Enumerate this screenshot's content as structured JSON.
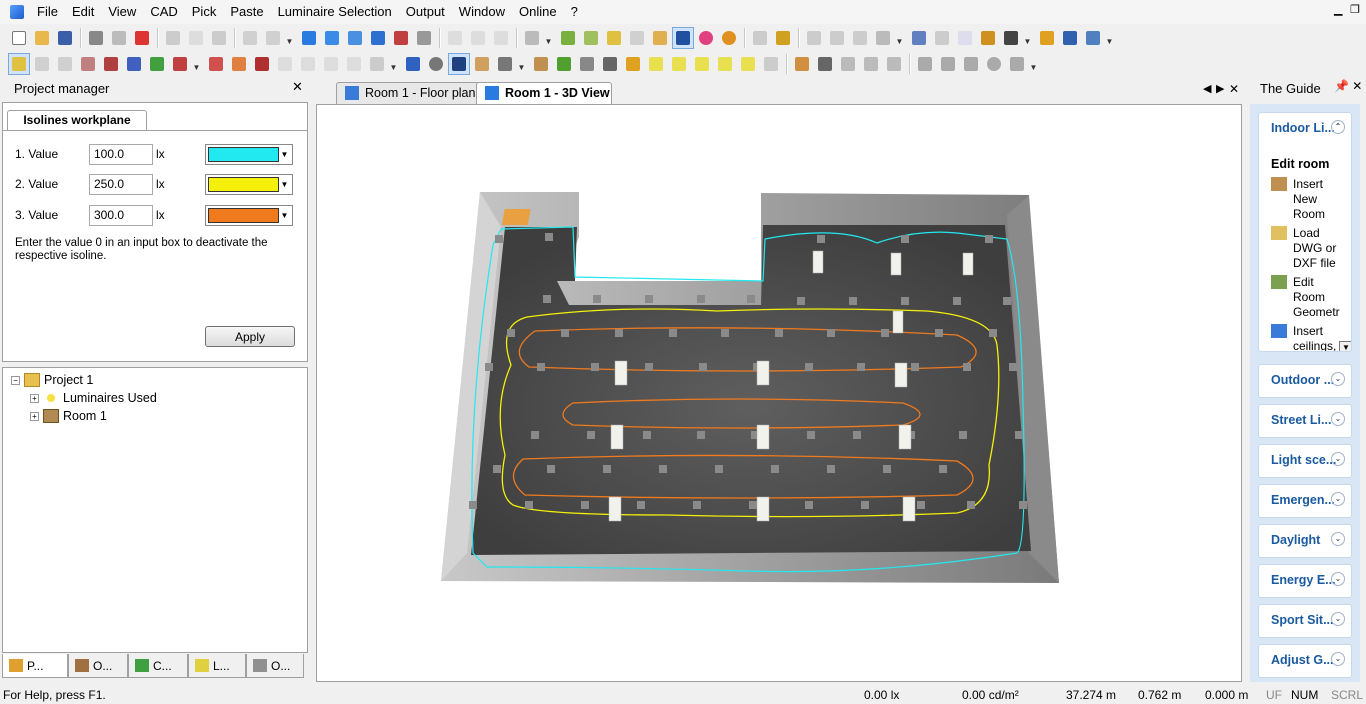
{
  "menu": {
    "items": [
      "File",
      "Edit",
      "View",
      "CAD",
      "Pick",
      "Paste",
      "Luminaire Selection",
      "Output",
      "Window",
      "Online",
      "?"
    ]
  },
  "project_manager": {
    "title": "Project manager",
    "tab": "Isolines workplane",
    "rows": [
      {
        "label": "1. Value",
        "value": "100.0",
        "unit": "lx",
        "color": "#22e8f0"
      },
      {
        "label": "2. Value",
        "value": "250.0",
        "unit": "lx",
        "color": "#f4f00a"
      },
      {
        "label": "3. Value",
        "value": "300.0",
        "unit": "lx",
        "color": "#f07a1e"
      }
    ],
    "hint": "Enter the value 0 in an input box to deactivate the respective isoline.",
    "apply": "Apply",
    "tree": {
      "project": "Project 1",
      "luminaires": "Luminaires Used",
      "room": "Room 1"
    },
    "bottom_tabs": [
      "P...",
      "O...",
      "C...",
      "L...",
      "O..."
    ]
  },
  "view": {
    "tabs": [
      "Room 1 - Floor plan",
      "Room 1 - 3D View"
    ]
  },
  "guide": {
    "title": "The Guide",
    "indoor": {
      "title": "Indoor Li...",
      "section": "Edit room",
      "items": [
        "Insert\nNew\nRoom",
        "Load\nDWG or\nDXF file",
        "Edit\nRoom\nGeometr",
        "Insert\nceilings,\nground"
      ]
    },
    "panels": [
      "Outdoor ...",
      "Street Li...",
      "Light sce...",
      "Emergen...",
      "Daylight",
      "Energy E...",
      "Sport Sit...",
      "Adjust G..."
    ]
  },
  "status": {
    "help": "For Help, press F1.",
    "lux": "0.00 lx",
    "lum": "0.00 cd/m²",
    "x": "37.274 m",
    "y": "0.762 m",
    "z": "0.000 m",
    "uf": "UF",
    "num": "NUM",
    "scrl": "SCRL"
  },
  "colors": {
    "isoline_cyan": "#22e8f0",
    "isoline_yellow": "#f4f00a",
    "isoline_orange": "#f07a1e",
    "guide_bg": "#d8e6f6",
    "guide_title": "#1a5aa0"
  }
}
